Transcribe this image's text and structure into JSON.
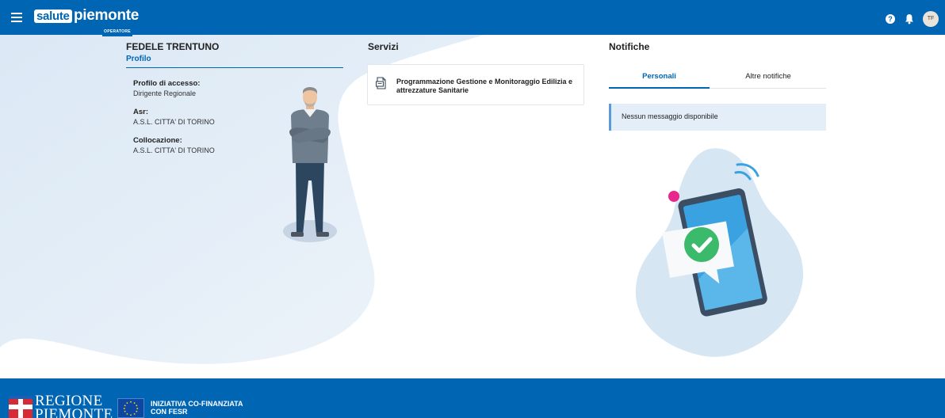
{
  "header": {
    "brand_box": "salute",
    "brand_word": "piemonte",
    "brand_sub": "OPERATORE",
    "menu_icon": "hamburger-icon",
    "help_icon": "question-circle-icon",
    "help_glyph": "?",
    "bell_icon": "bell-icon",
    "avatar_initials": "TF",
    "color": "#0065b3"
  },
  "profile": {
    "name": "FEDELE TRENTUNO",
    "link_label": "Profilo",
    "fields": [
      {
        "label": "Profilo di accesso:",
        "value": "Dirigente Regionale"
      },
      {
        "label": "Asr:",
        "value": "A.S.L. CITTA' DI TORINO"
      },
      {
        "label": "Collocazione:",
        "value": "A.S.L. CITTA' DI TORINO"
      }
    ]
  },
  "services": {
    "title": "Servizi",
    "items": [
      {
        "label": "Programmazione Gestione e Monitoraggio Edilizia e attrezzature Sanitarie",
        "icon": "document-icon"
      }
    ]
  },
  "notifications": {
    "title": "Notifiche",
    "tabs": [
      {
        "label": "Personali",
        "active": true
      },
      {
        "label": "Altre notifiche",
        "active": false
      }
    ],
    "message": "Nessun messaggio disponibile"
  },
  "footer": {
    "regione_line1": "REGIONE",
    "regione_line2": "PIEMONTE",
    "fesr_line1": "INIZIATIVA CO-FINANZIATA",
    "fesr_line2": "CON FESR"
  }
}
